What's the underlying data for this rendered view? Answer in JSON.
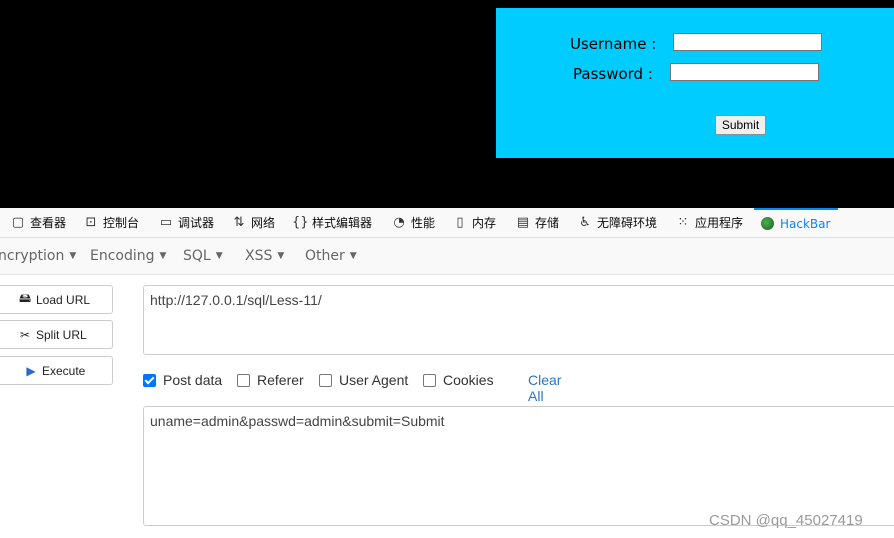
{
  "login": {
    "username_label": "Username :",
    "password_label": "Password :",
    "username_value": "",
    "password_value": "",
    "submit_label": "Submit"
  },
  "devtools": {
    "tabs": [
      {
        "label": "查看器",
        "icon": "inspector-icon"
      },
      {
        "label": "控制台",
        "icon": "console-icon"
      },
      {
        "label": "调试器",
        "icon": "debugger-icon"
      },
      {
        "label": "网络",
        "icon": "network-icon"
      },
      {
        "label": "样式编辑器",
        "icon": "style-editor-icon"
      },
      {
        "label": "性能",
        "icon": "performance-icon"
      },
      {
        "label": "内存",
        "icon": "memory-icon"
      },
      {
        "label": "存储",
        "icon": "storage-icon"
      },
      {
        "label": "无障碍环境",
        "icon": "accessibility-icon"
      },
      {
        "label": "应用程序",
        "icon": "application-icon"
      },
      {
        "label": "HackBar",
        "icon": "hackbar-icon",
        "active": true
      }
    ]
  },
  "hackbar": {
    "menu": {
      "encryption": "ncryption",
      "encoding": "Encoding",
      "sql": "SQL",
      "xss": "XSS",
      "other": "Other"
    },
    "buttons": {
      "load_url": "Load URL",
      "split_url": "Split URL",
      "execute": "Execute"
    },
    "url_value": "http://127.0.0.1/sql/Less-11/",
    "options": {
      "post_data": {
        "label": "Post data",
        "checked": true
      },
      "referer": {
        "label": "Referer",
        "checked": false
      },
      "user_agent": {
        "label": "User Agent",
        "checked": false
      },
      "cookies": {
        "label": "Cookies",
        "checked": false
      },
      "clear_all": "Clear All"
    },
    "post_value": "uname=admin&passwd=admin&submit=Submit"
  },
  "watermark": "CSDN @qq_45027419",
  "colors": {
    "login_bg": "#00ccff",
    "active_tab": "#0a84ff",
    "checkbox_checked": "#0075ff",
    "link": "#2c75c4"
  }
}
